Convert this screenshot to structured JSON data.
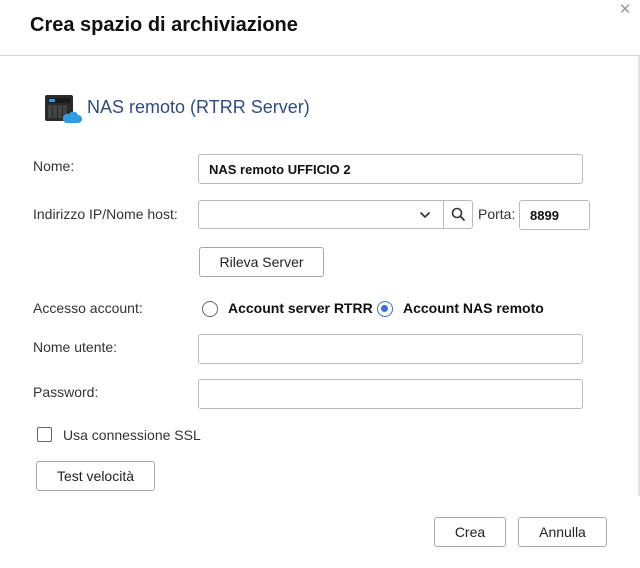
{
  "dialog": {
    "title": "Crea spazio di archiviazione",
    "close_icon": "close-icon"
  },
  "header": {
    "icon": "nas-cloud-icon",
    "title": "NAS remoto (RTRR Server)"
  },
  "form": {
    "name_label": "Nome:",
    "name_value": "NAS remoto UFFICIO 2",
    "host_label": "Indirizzo IP/Nome host:",
    "host_value": "",
    "port_label": "Porta:",
    "port_value": "8899",
    "detect_button": "Rileva Server",
    "access_label": "Accesso account:",
    "access_options": [
      {
        "label": "Account server RTRR",
        "checked": false
      },
      {
        "label": "Account NAS remoto",
        "checked": true
      }
    ],
    "username_label": "Nome utente:",
    "username_value": "",
    "password_label": "Password:",
    "password_value": "",
    "ssl_label": "Usa connessione SSL",
    "ssl_checked": false,
    "speed_test_button": "Test velocità"
  },
  "footer": {
    "create_button": "Crea",
    "cancel_button": "Annulla"
  },
  "colors": {
    "header_title": "#2f4b86",
    "radio_accent": "#3b6fd4",
    "cloud_icon": "#2f9be0"
  }
}
